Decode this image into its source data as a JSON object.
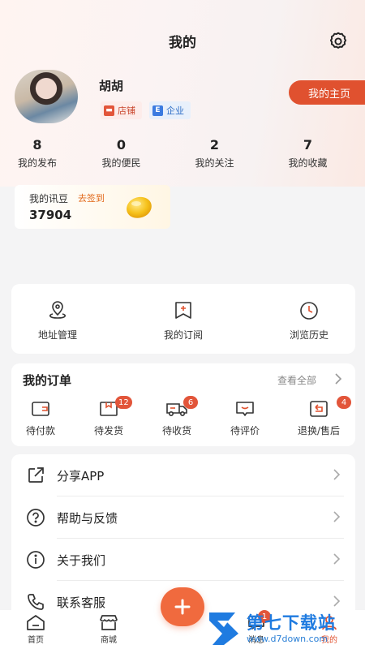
{
  "header": {
    "title": "我的"
  },
  "profile": {
    "name": "胡胡",
    "tags": [
      {
        "label": "店铺"
      },
      {
        "label": "企业"
      }
    ],
    "homepage_button": "我的主页"
  },
  "stats": [
    {
      "value": "8",
      "label": "我的发布"
    },
    {
      "value": "0",
      "label": "我的便民"
    },
    {
      "value": "2",
      "label": "我的关注"
    },
    {
      "value": "7",
      "label": "我的收藏"
    }
  ],
  "beans": {
    "label": "我的讯豆",
    "sign_in": "去签到",
    "value": "37904"
  },
  "tools": [
    {
      "label": "地址管理",
      "icon": "location-pin-icon"
    },
    {
      "label": "我的订阅",
      "icon": "subscribe-flag-icon"
    },
    {
      "label": "浏览历史",
      "icon": "clock-icon"
    }
  ],
  "orders": {
    "title": "我的订单",
    "view_all": "查看全部",
    "items": [
      {
        "label": "待付款",
        "icon": "wallet-icon",
        "badge": ""
      },
      {
        "label": "待发货",
        "icon": "package-icon",
        "badge": "12"
      },
      {
        "label": "待收货",
        "icon": "truck-icon",
        "badge": "6"
      },
      {
        "label": "待评价",
        "icon": "comment-icon",
        "badge": ""
      },
      {
        "label": "退换/售后",
        "icon": "return-icon",
        "badge": "4"
      }
    ]
  },
  "menu": [
    {
      "label": "分享APP",
      "icon": "share-icon"
    },
    {
      "label": "帮助与反馈",
      "icon": "help-icon"
    },
    {
      "label": "关于我们",
      "icon": "info-icon"
    },
    {
      "label": "联系客服",
      "icon": "phone-icon"
    }
  ],
  "tabbar": {
    "items": [
      {
        "label": "首页",
        "icon": "home-icon"
      },
      {
        "label": "商城",
        "icon": "store-icon"
      },
      {
        "label": "消息",
        "icon": "message-icon",
        "badge": "1"
      },
      {
        "label": "我的",
        "icon": "profile-icon"
      }
    ]
  },
  "watermark": {
    "title": "第七下载站",
    "url": "www.d7down.com"
  },
  "colors": {
    "accent": "#e0512f",
    "badge": "#e2553a",
    "fab": "#f06a3e",
    "watermark": "#1f7be0"
  }
}
